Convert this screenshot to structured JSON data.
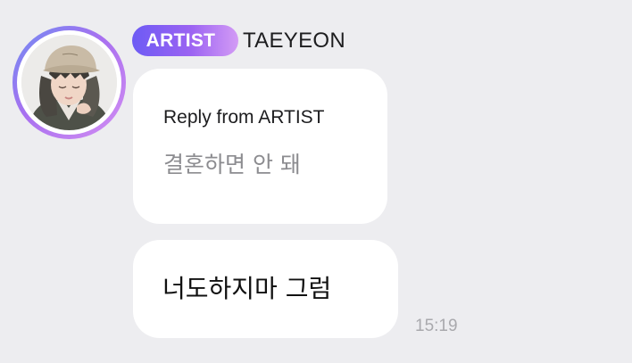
{
  "sender": {
    "badge_label": "ARTIST",
    "name": "TAEYEON",
    "avatar_description": "profile-photo"
  },
  "reply": {
    "header": "Reply from ARTIST",
    "quoted_text": "결혼하면 안 돼"
  },
  "message": {
    "text": "너도하지마 그럼",
    "time": "15:19"
  },
  "colors": {
    "background": "#ededf0",
    "bubble": "#ffffff",
    "badge_gradient_start": "#6d5bf4",
    "badge_gradient_end": "#d39bf5",
    "quote_text": "#8c8c90",
    "timestamp": "#a9a9ad"
  }
}
